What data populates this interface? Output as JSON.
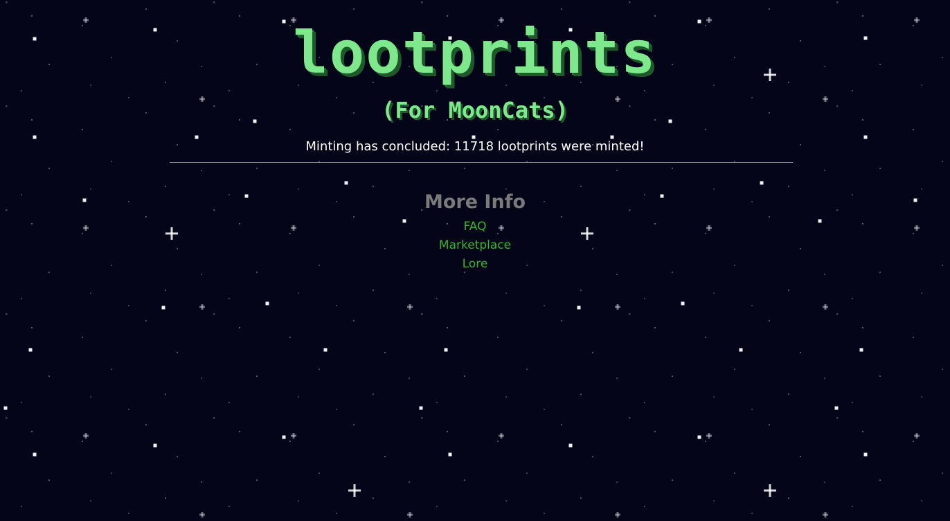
{
  "header": {
    "title": "lootprints",
    "subtitle": "(For MoonCats)"
  },
  "status_text": "Minting has concluded: 11718 lootprints were minted!",
  "more_info": {
    "heading": "More Info",
    "links": [
      {
        "label": "FAQ"
      },
      {
        "label": "Marketplace"
      },
      {
        "label": "Lore"
      }
    ]
  },
  "colors": {
    "background": "#05051a",
    "title_green": "#7ee88c",
    "link_green": "#2fb82f",
    "heading_gray": "#7a7a7a",
    "star_white": "#ffffff"
  }
}
